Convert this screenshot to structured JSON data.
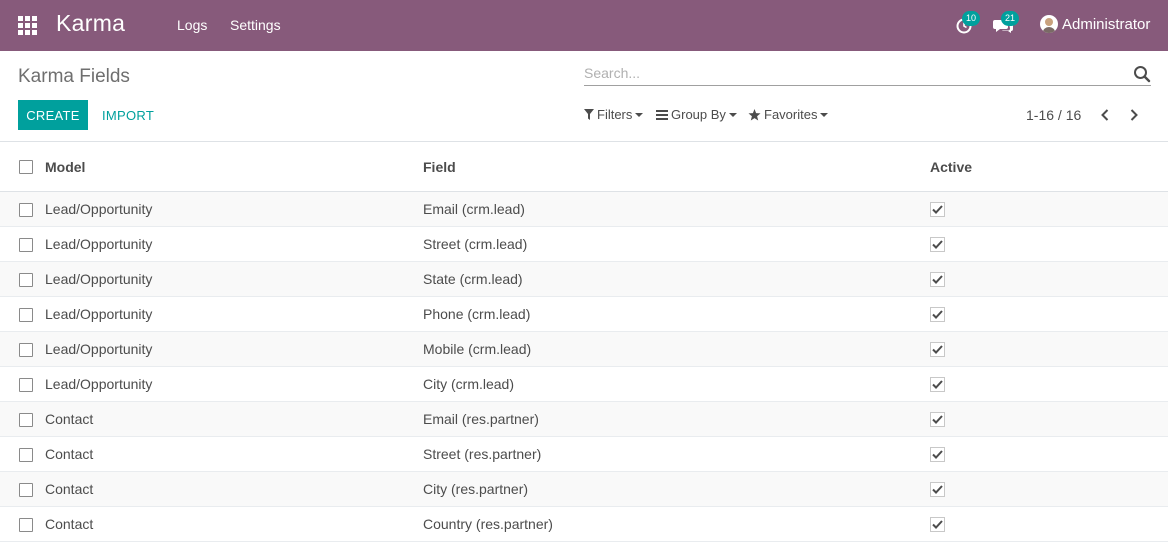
{
  "navbar": {
    "brand": "Karma",
    "menu": [
      "Logs",
      "Settings"
    ],
    "activity_badge": "10",
    "messages_badge": "21",
    "user_name": "Administrator"
  },
  "control_panel": {
    "title": "Karma Fields",
    "search_placeholder": "Search...",
    "create_label": "CREATE",
    "import_label": "IMPORT",
    "filters_label": "Filters",
    "groupby_label": "Group By",
    "favorites_label": "Favorites",
    "pager_value": "1-16 / 16"
  },
  "table": {
    "columns": [
      "Model",
      "Field",
      "Active"
    ],
    "rows": [
      {
        "model": "Lead/Opportunity",
        "field": "Email (crm.lead)",
        "active": true
      },
      {
        "model": "Lead/Opportunity",
        "field": "Street (crm.lead)",
        "active": true
      },
      {
        "model": "Lead/Opportunity",
        "field": "State (crm.lead)",
        "active": true
      },
      {
        "model": "Lead/Opportunity",
        "field": "Phone (crm.lead)",
        "active": true
      },
      {
        "model": "Lead/Opportunity",
        "field": "Mobile (crm.lead)",
        "active": true
      },
      {
        "model": "Lead/Opportunity",
        "field": "City (crm.lead)",
        "active": true
      },
      {
        "model": "Contact",
        "field": "Email (res.partner)",
        "active": true
      },
      {
        "model": "Contact",
        "field": "Street (res.partner)",
        "active": true
      },
      {
        "model": "Contact",
        "field": "City (res.partner)",
        "active": true
      },
      {
        "model": "Contact",
        "field": "Country (res.partner)",
        "active": true
      }
    ]
  },
  "colors": {
    "navbar": "#875a7b",
    "primary": "#00a09d",
    "text": "#4c4c4c"
  },
  "icons": {
    "apps": "apps-grid-icon",
    "activity": "clock-icon",
    "messages": "chat-bubbles-icon",
    "search": "search-icon",
    "filters": "filter-icon",
    "groupby": "list-bars-icon",
    "favorites": "star-icon",
    "pager_prev": "chevron-left-icon",
    "pager_next": "chevron-right-icon",
    "check": "check-icon"
  }
}
